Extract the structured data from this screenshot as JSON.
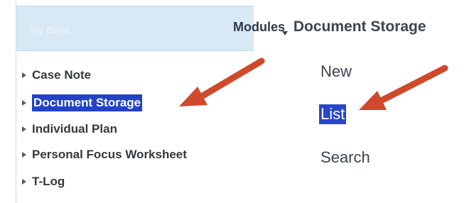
{
  "panel": {
    "title": "My Case"
  },
  "sidebar": {
    "items": [
      {
        "label": "Case Note",
        "selected": false
      },
      {
        "label": "Document Storage",
        "selected": true
      },
      {
        "label": "Individual Plan",
        "selected": false
      },
      {
        "label": "Personal Focus Worksheet",
        "selected": false
      },
      {
        "label": "T-Log",
        "selected": false
      }
    ]
  },
  "breadcrumb": {
    "root": "Modules",
    "current": "Document Storage"
  },
  "actions": [
    {
      "label": "New",
      "selected": false
    },
    {
      "label": "List",
      "selected": true
    },
    {
      "label": "Search",
      "selected": false
    }
  ],
  "colors": {
    "header_bg": "#d8e9f6",
    "selection": "#2342c9",
    "arrow": "#d1492a"
  },
  "icons": {
    "tree_caret": "caret-right-icon",
    "breadcrumb_sep": "caret-down-icon",
    "annotation": "red-arrow-icon"
  }
}
